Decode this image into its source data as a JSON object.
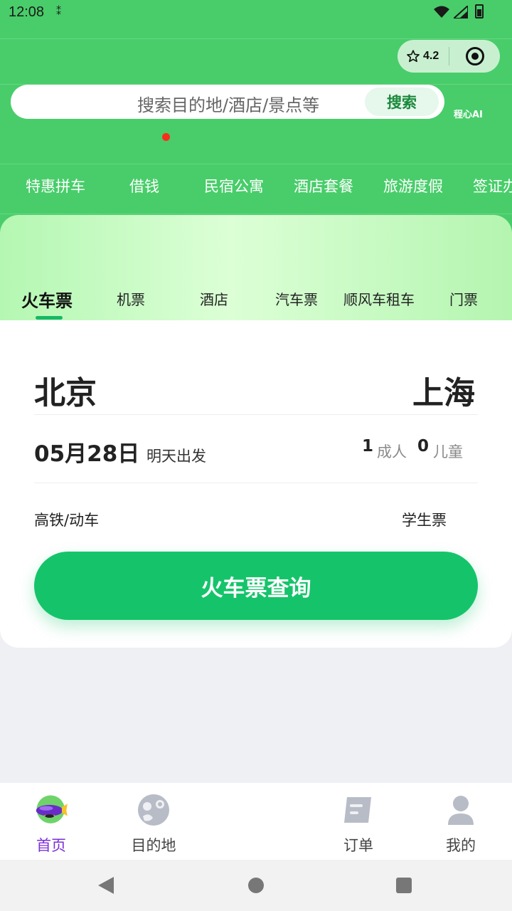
{
  "status_bar": {
    "time": "12:08",
    "notification_glyph": "⁑"
  },
  "capsule": {
    "rating": "4.2"
  },
  "search": {
    "placeholder": "搜索目的地/酒店/景点等",
    "button": "搜索",
    "ai_label": "程心AI"
  },
  "quick_nav": [
    "特惠拼车",
    "借钱",
    "民宿公寓",
    "酒店套餐",
    "旅游度假",
    "签证办"
  ],
  "tabs": [
    {
      "label": "火车票",
      "active": true
    },
    {
      "label": "机票"
    },
    {
      "label": "酒店"
    },
    {
      "label": "汽车票"
    },
    {
      "label": "顺风车租车"
    },
    {
      "label": "门票"
    }
  ],
  "booking": {
    "from_city": "北京",
    "to_city": "上海",
    "date": "05月28日",
    "date_note": "明天出发",
    "adults_count": "1",
    "adults_label": "成人",
    "children_count": "0",
    "children_label": "儿童",
    "option_left": "高铁/动车",
    "option_right": "学生票",
    "search_button": "火车票查询"
  },
  "tabbar": [
    {
      "label": "首页",
      "icon": "airship-home-icon",
      "active": true
    },
    {
      "label": "目的地",
      "icon": "palette-icon"
    },
    {
      "label": "订单",
      "icon": "orders-icon"
    },
    {
      "label": "我的",
      "icon": "profile-icon"
    }
  ],
  "colors": {
    "header_green": "#48cd6a",
    "primary_green": "#15c46a",
    "active_purple": "#7b2fd8"
  }
}
